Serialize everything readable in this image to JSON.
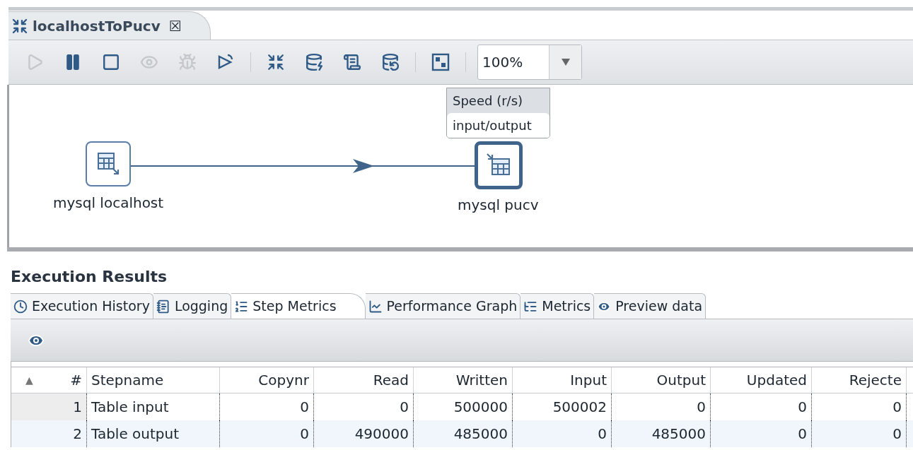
{
  "editor_tab": {
    "title": "localhostToPucv",
    "close": "☒"
  },
  "toolbar": [
    {
      "kind": "run",
      "disabled": true
    },
    {
      "kind": "pause",
      "disabled": false
    },
    {
      "kind": "stop",
      "disabled": false
    },
    {
      "kind": "preview",
      "disabled": true
    },
    {
      "kind": "debug",
      "disabled": true
    },
    {
      "kind": "replay",
      "disabled": false
    },
    {
      "kind": "separator"
    },
    {
      "kind": "verify",
      "disabled": false
    },
    {
      "kind": "impact",
      "disabled": false
    },
    {
      "kind": "sql",
      "disabled": false
    },
    {
      "kind": "explore",
      "disabled": false
    },
    {
      "kind": "separator"
    },
    {
      "kind": "grid",
      "disabled": false
    },
    {
      "kind": "separator"
    }
  ],
  "zoom": {
    "value": "100%"
  },
  "tooltip": {
    "lines": [
      "Speed (r/s)",
      "input/output"
    ]
  },
  "canvas": {
    "nodes": [
      {
        "label": "mysql localhost",
        "kind": "input",
        "selected": false
      },
      {
        "label": "mysql pucv",
        "kind": "output",
        "selected": true
      }
    ]
  },
  "results": {
    "title": "Execution Results",
    "tabs": [
      {
        "label": "Execution History",
        "kind": "history",
        "selected": false
      },
      {
        "label": "Logging",
        "kind": "logging",
        "selected": false
      },
      {
        "label": "Step Metrics",
        "kind": "steps",
        "selected": true
      },
      {
        "label": "Performance Graph",
        "kind": "graph",
        "selected": false
      },
      {
        "label": "Metrics",
        "kind": "metrics",
        "selected": false
      },
      {
        "label": "Preview data",
        "kind": "preview",
        "selected": false
      }
    ],
    "table": {
      "sort_mark": "▲",
      "columns": [
        "#",
        "Stepname",
        "Copynr",
        "Read",
        "Written",
        "Input",
        "Output",
        "Updated",
        "Rejecte"
      ],
      "rows": [
        [
          "1",
          "Table input",
          "0",
          "0",
          "500000",
          "500002",
          "0",
          "0",
          "0"
        ],
        [
          "2",
          "Table output",
          "0",
          "490000",
          "485000",
          "0",
          "485000",
          "0",
          "0"
        ]
      ]
    }
  }
}
